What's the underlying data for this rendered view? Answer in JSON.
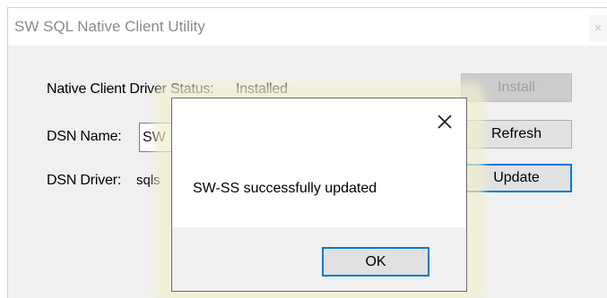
{
  "window": {
    "title": "SW SQL Native Client Utility"
  },
  "form": {
    "driver_status_label": "Native Client Driver Status:",
    "driver_status_value": "Installed",
    "dsn_name_label": "DSN Name:",
    "dsn_name_value": "SW",
    "dsn_driver_label": "DSN Driver:",
    "dsn_driver_value": "sqls"
  },
  "buttons": {
    "install": "Install",
    "refresh": "Refresh",
    "update": "Update"
  },
  "dialog": {
    "message": "SW-SS successfully updated",
    "ok": "OK"
  },
  "icons": {
    "window_close": "close-icon",
    "dialog_close": "close-icon"
  },
  "colors": {
    "focus_border": "#0078d7",
    "window_bg": "#f0f0f0",
    "glow": "#f2eecd"
  }
}
